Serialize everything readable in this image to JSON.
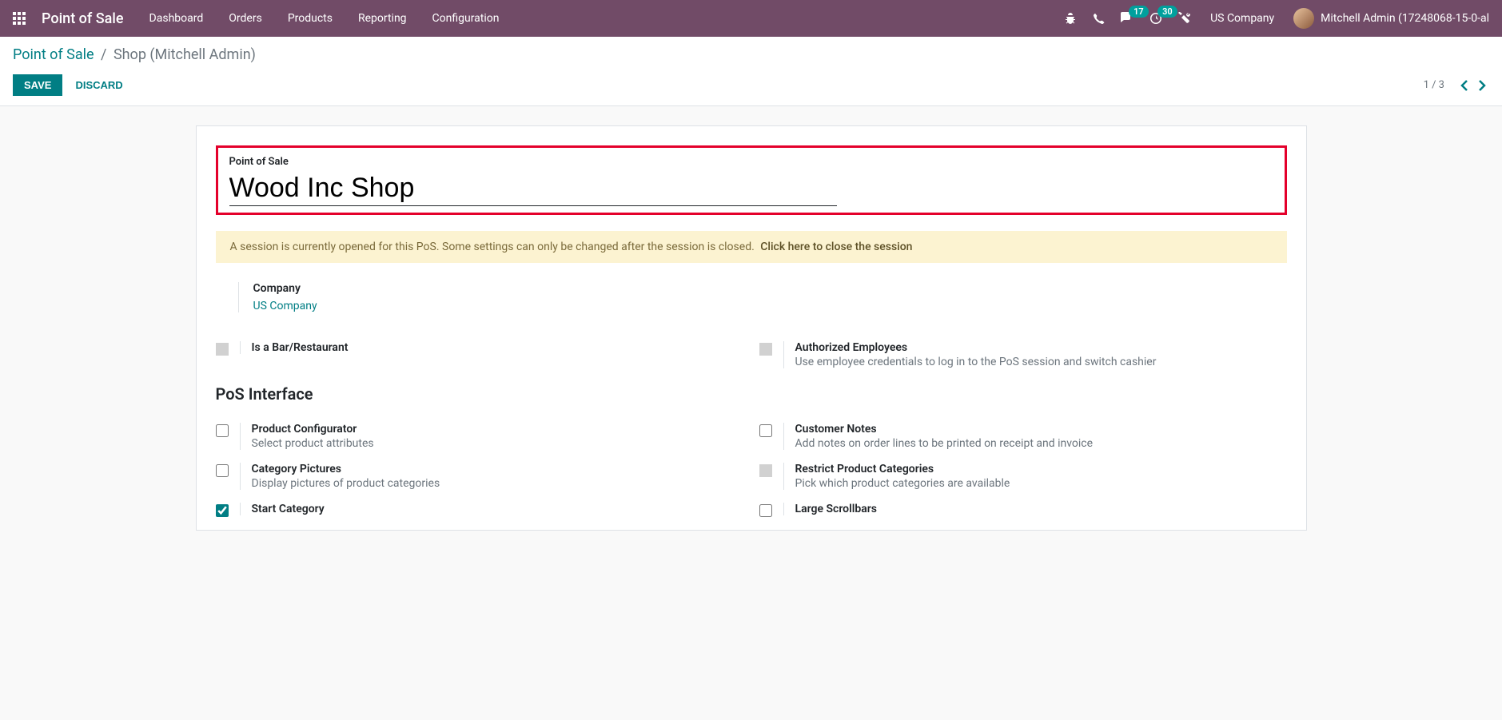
{
  "navbar": {
    "brand": "Point of Sale",
    "menu": [
      "Dashboard",
      "Orders",
      "Products",
      "Reporting",
      "Configuration"
    ],
    "msg_badge": "17",
    "activity_badge": "30",
    "company": "US Company",
    "user": "Mitchell Admin (17248068-15-0-al"
  },
  "breadcrumb": {
    "root": "Point of Sale",
    "current": "Shop (Mitchell Admin)"
  },
  "buttons": {
    "save": "SAVE",
    "discard": "DISCARD"
  },
  "pager": "1 / 3",
  "form": {
    "title_label": "Point of Sale",
    "title_value": "Wood Inc Shop",
    "alert_text": "A session is currently opened for this PoS. Some settings can only be changed after the session is closed.",
    "alert_link": "Click here to close the session",
    "company_label": "Company",
    "company_value": "US Company"
  },
  "settings": {
    "bar_restaurant": {
      "title": "Is a Bar/Restaurant"
    },
    "authorized_employees": {
      "title": "Authorized Employees",
      "desc": "Use employee credentials to log in to the PoS session and switch cashier"
    },
    "section_interface": "PoS Interface",
    "product_configurator": {
      "title": "Product Configurator",
      "desc": "Select product attributes"
    },
    "customer_notes": {
      "title": "Customer Notes",
      "desc": "Add notes on order lines to be printed on receipt and invoice"
    },
    "category_pictures": {
      "title": "Category Pictures",
      "desc": "Display pictures of product categories"
    },
    "restrict_categories": {
      "title": "Restrict Product Categories",
      "desc": "Pick which product categories are available"
    },
    "start_category": {
      "title": "Start Category"
    },
    "large_scrollbars": {
      "title": "Large Scrollbars"
    }
  }
}
